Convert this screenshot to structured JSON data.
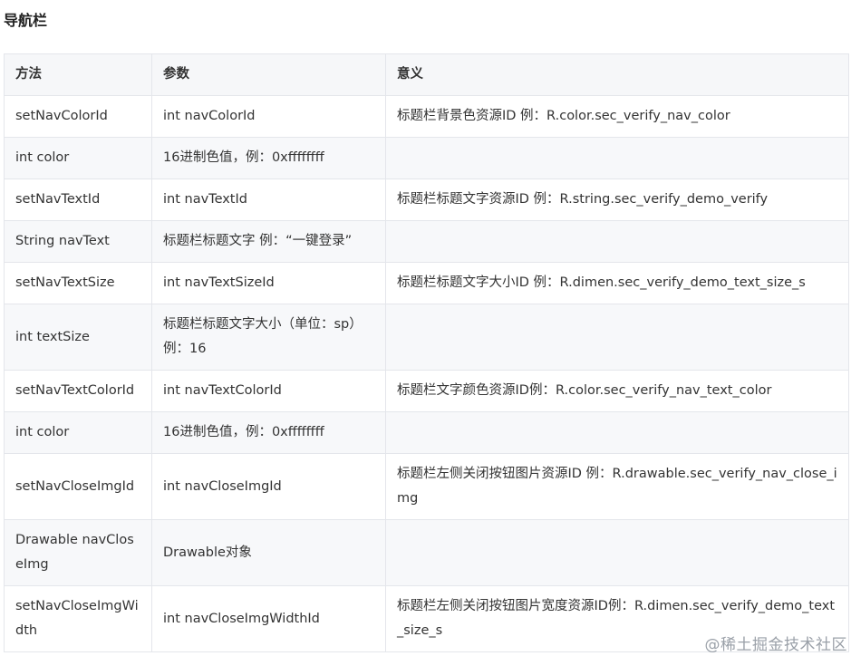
{
  "heading": "导航栏",
  "table": {
    "headers": [
      "方法",
      "参数",
      "意义"
    ],
    "rows": [
      [
        "setNavColorId",
        "int navColorId",
        "标题栏背景色资源ID 例：R.color.sec_verify_nav_color"
      ],
      [
        "int color",
        "16进制色值，例：0xffffffff",
        ""
      ],
      [
        "setNavTextId",
        "int navTextId",
        "标题栏标题文字资源ID 例：R.string.sec_verify_demo_verify"
      ],
      [
        "String navText",
        "标题栏标题文字 例：“一键登录”",
        ""
      ],
      [
        "setNavTextSize",
        "int navTextSizeId",
        "标题栏标题文字大小ID 例：R.dimen.sec_verify_demo_text_size_s"
      ],
      [
        "int textSize",
        "标题栏标题文字大小（单位：sp）例：16",
        ""
      ],
      [
        "setNavTextColorId",
        "int navTextColorId",
        "标题栏文字颜色资源ID例：R.color.sec_verify_nav_text_color"
      ],
      [
        "int color",
        "16进制色值，例：0xffffffff",
        ""
      ],
      [
        "setNavCloseImgId",
        "int navCloseImgId",
        "标题栏左侧关闭按钮图片资源ID 例：R.drawable.sec_verify_nav_close_img"
      ],
      [
        "Drawable navCloseImg",
        "Drawable对象",
        ""
      ],
      [
        "setNavCloseImgWidth",
        "int navCloseImgWidthId",
        "标题栏左侧关闭按钮图片宽度资源ID例：R.dimen.sec_verify_demo_text_size_s"
      ]
    ]
  },
  "watermark": "@稀土掘金技术社区"
}
